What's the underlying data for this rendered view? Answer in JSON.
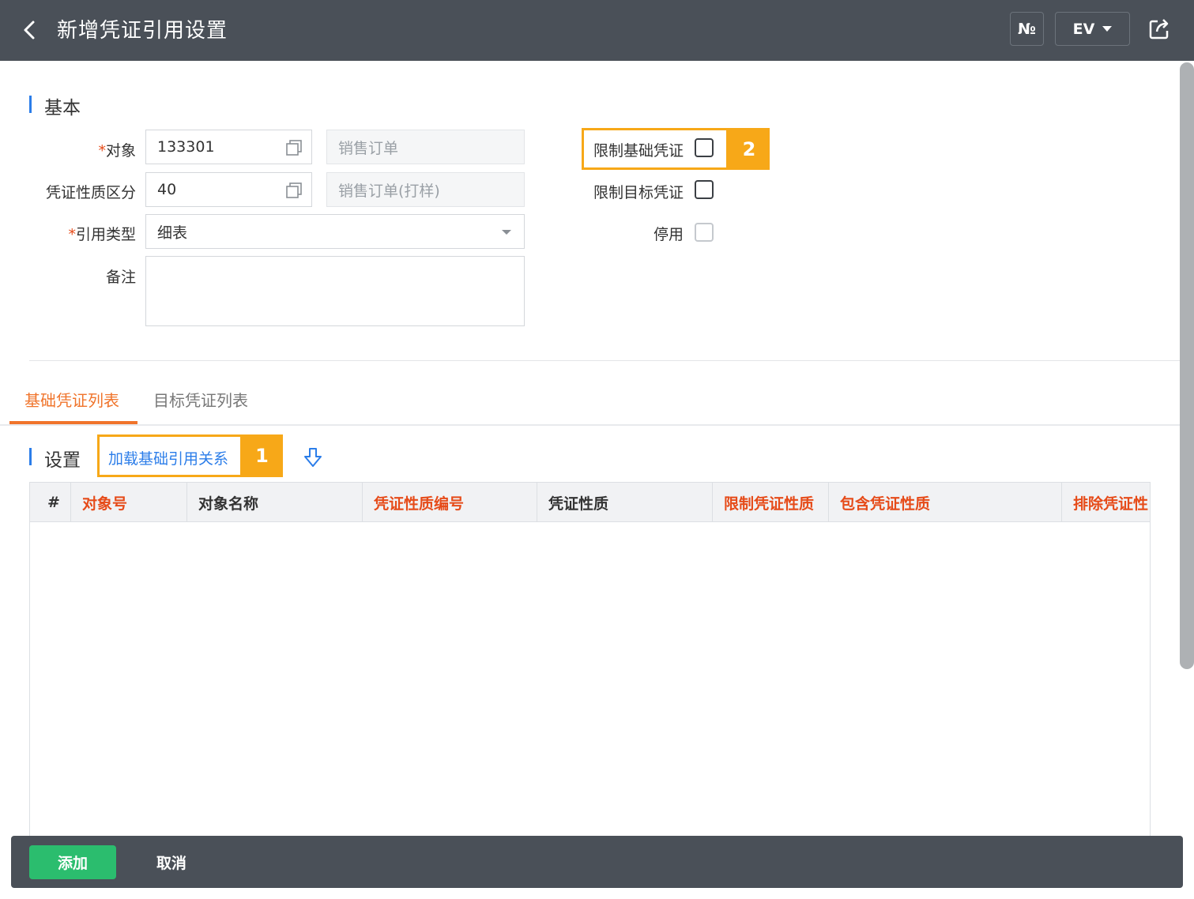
{
  "header": {
    "title": "新增凭证引用设置",
    "no_label": "№",
    "ev_label": "EV"
  },
  "basic": {
    "section_title": "基本",
    "object_label": "对象",
    "object_value": "133301",
    "object_name": "销售订单",
    "nature_label": "凭证性质区分",
    "nature_value": "40",
    "nature_name": "销售订单(打样)",
    "ref_type_label": "引用类型",
    "ref_type_value": "细表",
    "remark_label": "备注",
    "remark_value": "",
    "limit_base_label": "限制基础凭证",
    "limit_target_label": "限制目标凭证",
    "disabled_label": "停用",
    "limit_base_checked": false,
    "limit_target_checked": false,
    "disabled_checked": false
  },
  "tabs": [
    {
      "label": "基础凭证列表",
      "active": true
    },
    {
      "label": "目标凭证列表",
      "active": false
    }
  ],
  "settings": {
    "section_title": "设置",
    "load_link": "加载基础引用关系"
  },
  "callouts": {
    "one": "1",
    "two": "2"
  },
  "table": {
    "columns": [
      "#",
      "对象号",
      "对象名称",
      "凭证性质编号",
      "凭证性质",
      "限制凭证性质",
      "包含凭证性质",
      "排除凭证性"
    ],
    "rows": []
  },
  "footer": {
    "add": "添加",
    "cancel": "取消"
  },
  "colors": {
    "header_bg": "#4a5058",
    "accent_orange": "#f0742b",
    "highlight": "#f7a818",
    "link_blue": "#2b7de9",
    "required_red": "#e64b19",
    "add_green": "#2bbd6e"
  }
}
